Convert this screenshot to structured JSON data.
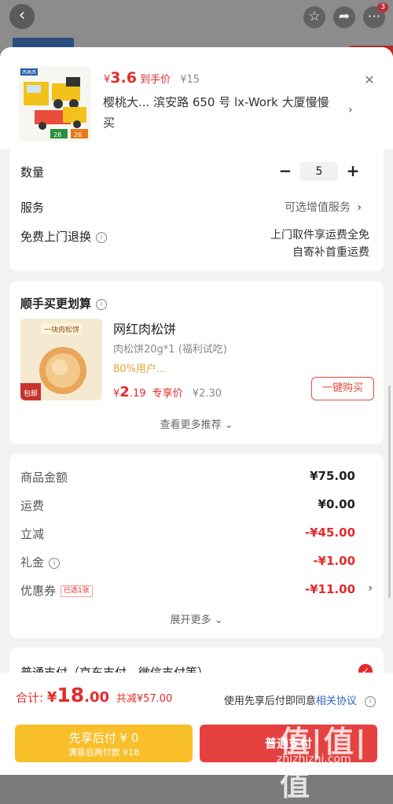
{
  "background": {
    "badge_count": "3",
    "back_icon": "back-arrow-icon",
    "icons": [
      "star-icon",
      "share-icon",
      "more-icon"
    ]
  },
  "product": {
    "price_currency": "¥",
    "price_value": "3.6",
    "price_label": "到手价",
    "original_price": "¥15",
    "title_line1": "樱桃大...  滨安路 650 号 lx-Work 大厦慢慢",
    "title_line2": "买",
    "image_brand": "西高西",
    "image_badge1": "28",
    "image_badge2": "26"
  },
  "quantity": {
    "label": "数量",
    "minus": "−",
    "value": "5",
    "plus": "+"
  },
  "service": {
    "label": "服务",
    "value": "可选增值服务"
  },
  "free_return": {
    "label": "免费上门退换",
    "line1": "上门取件享运费全免",
    "line2": "自寄补首重运费"
  },
  "deal": {
    "title": "顺手买更划算",
    "name": "网红肉松饼",
    "spec": "肉松饼20g*1 (福利试吃)",
    "percent": "80%用户...",
    "price_cur": "¥",
    "price_int": "2",
    "price_dec": ".19",
    "price_label": "专享价",
    "orig": "¥2.30",
    "buy_button": "一键购买",
    "more": "查看更多推荐",
    "image_text": "一块肉松饼",
    "image_tag": "包邮"
  },
  "amounts": {
    "rows": [
      {
        "label": "商品金额",
        "value": "¥75.00"
      },
      {
        "label": "运费",
        "value": "¥0.00"
      },
      {
        "label": "立减",
        "value": "-¥45.00"
      },
      {
        "label": "礼金",
        "value": "-¥1.00"
      },
      {
        "label": "优惠券",
        "value": "-¥11.00",
        "tag": "已选1张"
      }
    ],
    "expand": "展开更多"
  },
  "payment": {
    "title": "普通支付（京东支付、微信支付等）"
  },
  "bottom": {
    "total_label": "合计:",
    "total_cur": "¥",
    "total_int": "18",
    "total_dec": ".00",
    "saved": "共减¥57.00",
    "agree_text": "使用先享后付即同意",
    "agree_link": "相关协议",
    "later_line1": "先享后付 ¥ 0",
    "later_line2": "满意后再付款 ¥18",
    "pay_button": "普通支付"
  },
  "watermark": {
    "big": "值|值|值",
    "small": "zhizhizhi.com"
  }
}
